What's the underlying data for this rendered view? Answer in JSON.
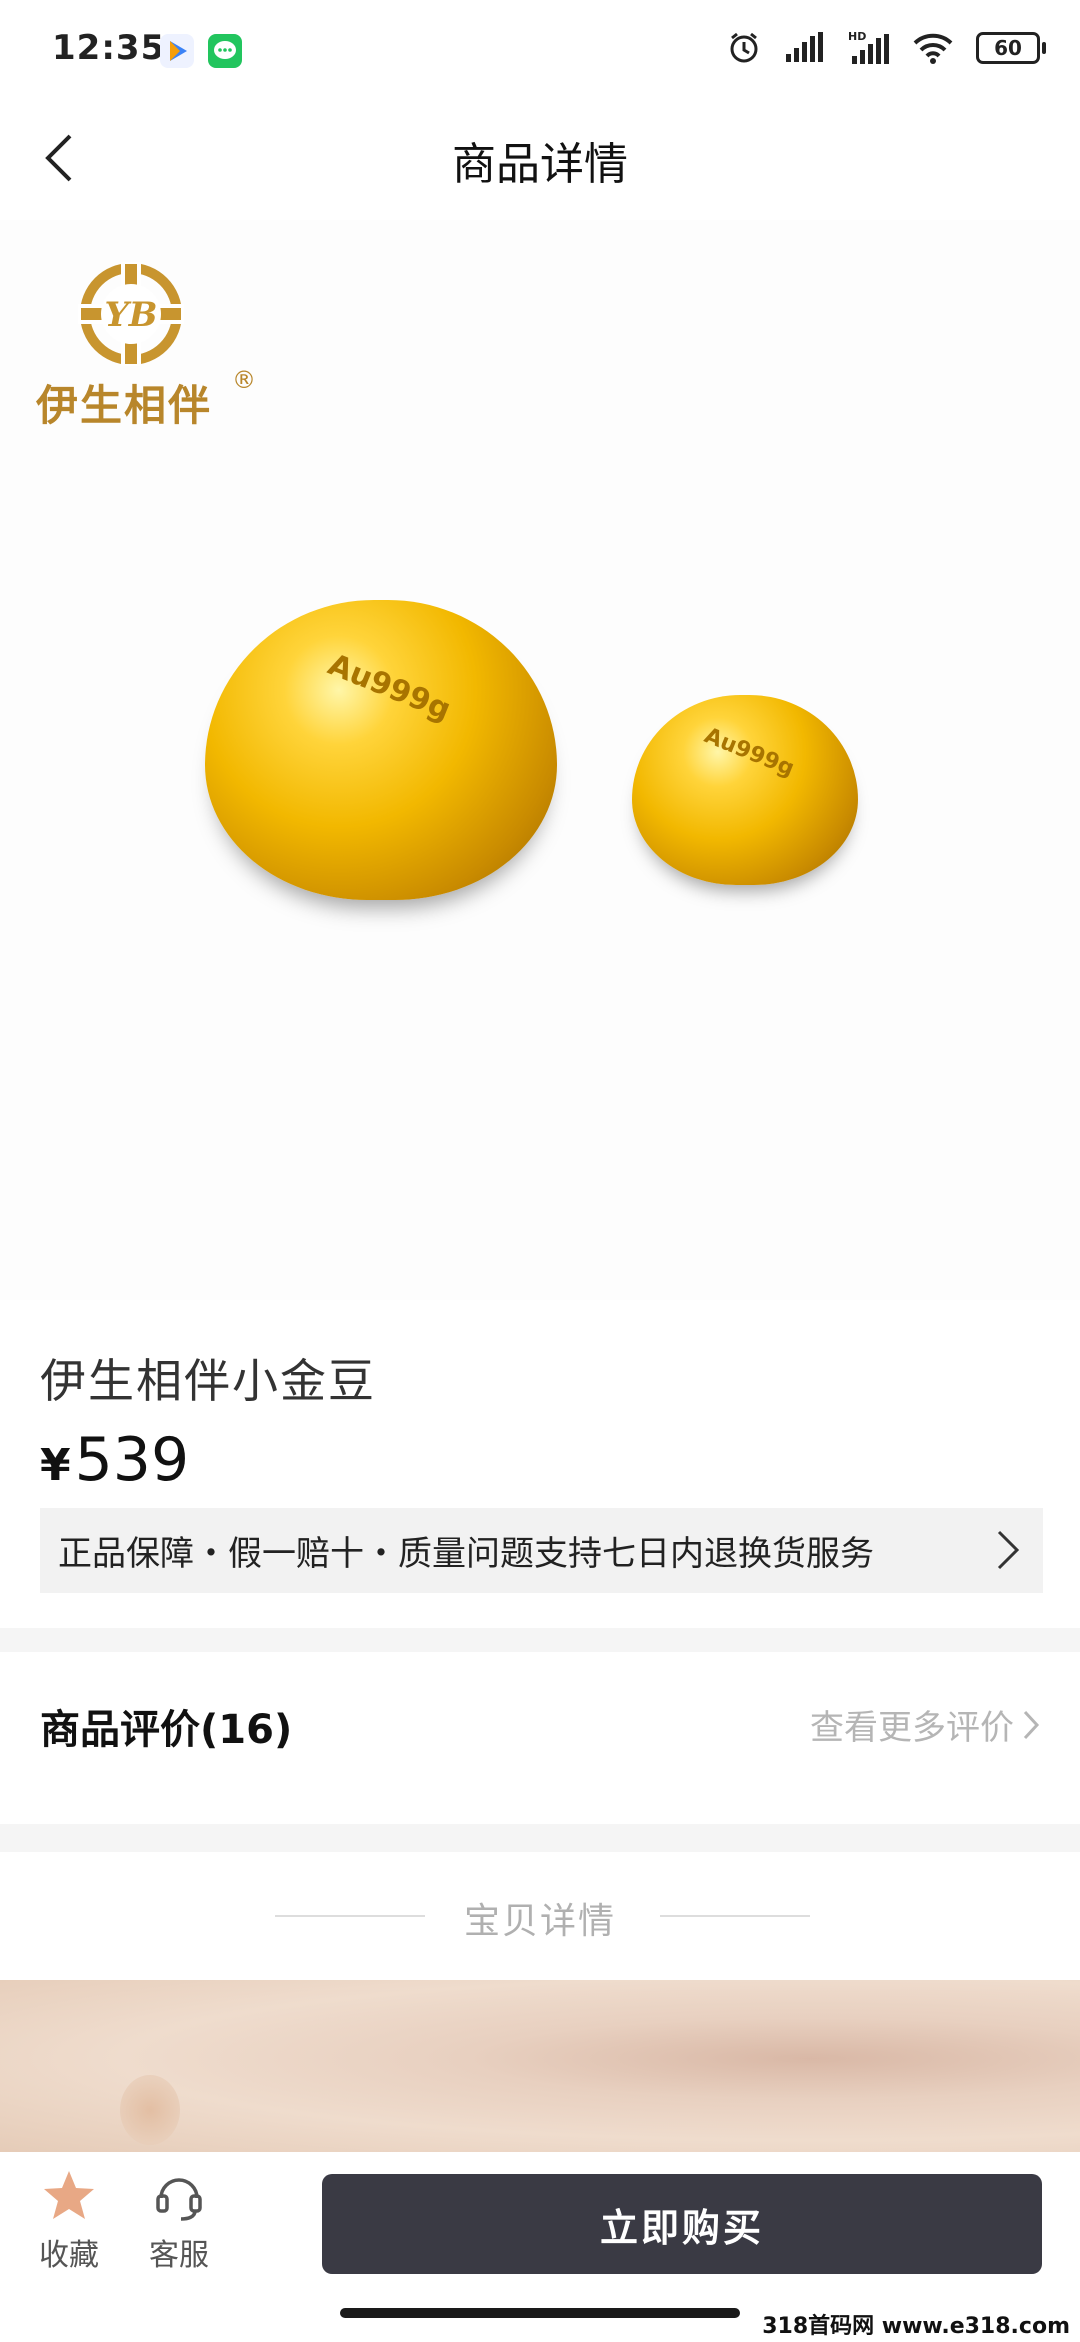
{
  "status_bar": {
    "time": "12:35",
    "battery": "60"
  },
  "header": {
    "title": "商品详情"
  },
  "brand": {
    "logo_text": "伊生相伴",
    "registered_mark": "®",
    "logo_monogram": "YB"
  },
  "product_image": {
    "engraving": "Au999g"
  },
  "product": {
    "name": "伊生相伴小金豆",
    "currency_symbol": "¥",
    "price": "539",
    "guarantee": "正品保障・假一赔十・质量问题支持七日内退换货服务"
  },
  "reviews": {
    "title": "商品评价(16)",
    "more_label": "查看更多评价"
  },
  "detail": {
    "section_label": "宝贝详情"
  },
  "bottom_bar": {
    "favorite_label": "收藏",
    "service_label": "客服",
    "buy_label": "立即购买"
  },
  "watermark": "318首码网 www.e318.com",
  "colors": {
    "brand_gold": "#b8862b",
    "buy_button": "#3a3a44",
    "favorite_star": "#e8a885"
  }
}
